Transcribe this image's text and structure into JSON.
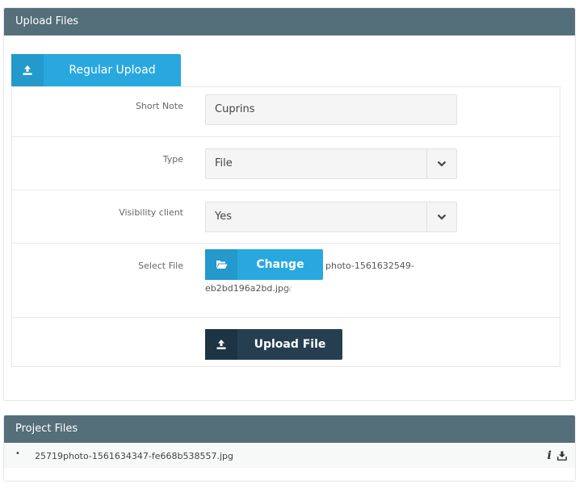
{
  "upload_panel": {
    "title": "Upload Files"
  },
  "tab": {
    "label": "Regular Upload",
    "icon": "upload-icon"
  },
  "form": {
    "short_note": {
      "label": "Short Note",
      "value": "Cuprins"
    },
    "type": {
      "label": "Type",
      "value": "File"
    },
    "visibility": {
      "label": "Visibility client",
      "value": "Yes"
    },
    "select_file": {
      "label": "Select File",
      "button_label": "Change",
      "filename_part1": "photo-1561632549-",
      "filename_part2": "eb2bd196a2bd.jpg",
      "remove_glyph": "×"
    },
    "submit": {
      "label": "Upload File"
    }
  },
  "project_panel": {
    "title": "Project Files",
    "files": [
      {
        "bullet": "•",
        "name": "25719photo-1561634347-fe668b538557.jpg"
      }
    ]
  },
  "colors": {
    "header": "#546e7a",
    "accent": "#29a8df",
    "dark_button": "#253f50"
  }
}
